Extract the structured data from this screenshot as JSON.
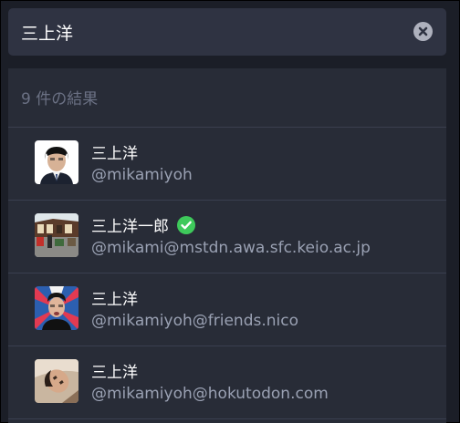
{
  "search": {
    "value": "三上洋",
    "clear_icon": "close-circle-icon"
  },
  "results": {
    "count_text": "9 件の結果",
    "accounts": [
      {
        "display_name": "三上洋",
        "acct": "@mikamiyoh",
        "verified": false,
        "avatar_icon": "avatar-photo"
      },
      {
        "display_name": "三上洋一郎",
        "acct": "@mikami@mstdn.awa.sfc.keio.ac.jp",
        "verified": true,
        "verified_icon": "check-circle-icon",
        "verified_color": "#3ec95b",
        "avatar_icon": "avatar-photo"
      },
      {
        "display_name": "三上洋",
        "acct": "@mikamiyoh@friends.nico",
        "verified": false,
        "avatar_icon": "avatar-photo"
      },
      {
        "display_name": "三上洋",
        "acct": "@mikamiyoh@hokutodon.com",
        "verified": false,
        "avatar_icon": "avatar-photo"
      }
    ]
  },
  "colors": {
    "background": "#1b1e27",
    "search_bg": "#2f3342",
    "panel_bg": "#282c37",
    "divider": "#3a3f4f",
    "secondary_text": "#9aa1b3",
    "count_text": "#6b7184"
  }
}
